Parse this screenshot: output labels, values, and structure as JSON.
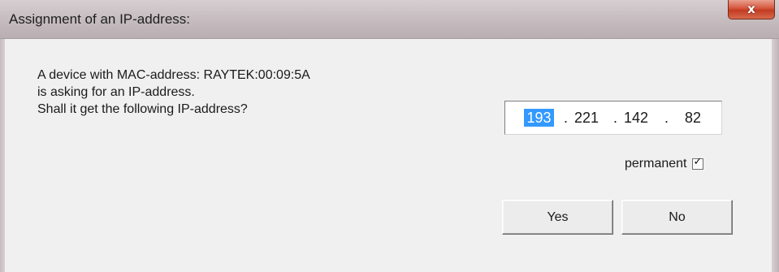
{
  "window": {
    "title": "Assignment of an IP-address:",
    "close_glyph": "x"
  },
  "message": {
    "line1": "A device with MAC-address: RAYTEK:00:09:5A",
    "line2": "is asking for an IP-address.",
    "line3": "Shall it get the following IP-address?"
  },
  "ip_address": {
    "octet1": "193",
    "octet2": "221",
    "octet3": "142",
    "octet4": "82",
    "separator": ".",
    "selected_octet": 1
  },
  "permanent": {
    "label": "permanent",
    "checked": true,
    "check_glyph": "✓"
  },
  "buttons": {
    "yes_label": "Yes",
    "no_label": "No"
  },
  "colors": {
    "selection": "#3399ff",
    "close_button": "#c23b22"
  }
}
